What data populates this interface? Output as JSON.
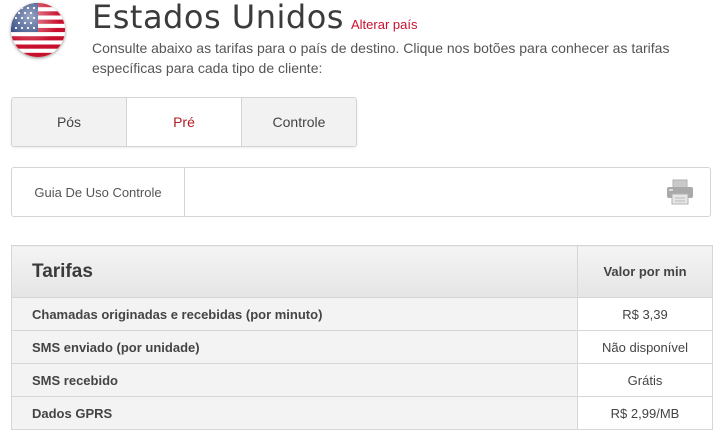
{
  "header": {
    "country_name": "Estados Unidos",
    "change_link": "Alterar país",
    "description": "Consulte abaixo as tarifas para o país de destino. Clique nos botões para conhecer as tarifas específicas para cada tipo de cliente:"
  },
  "tabs": [
    {
      "label": "Pós",
      "active": false
    },
    {
      "label": "Pré",
      "active": true
    },
    {
      "label": "Controle",
      "active": false
    }
  ],
  "guide": {
    "label": "Guia De Uso Controle",
    "print_icon": "printer-icon"
  },
  "tariffs": {
    "header_title": "Tarifas",
    "header_value": "Valor por min",
    "rows": [
      {
        "label": "Chamadas originadas e recebidas (por minuto)",
        "value": "R$ 3,39"
      },
      {
        "label": "SMS enviado (por unidade)",
        "value": "Não disponível"
      },
      {
        "label": "SMS recebido",
        "value": "Grátis"
      },
      {
        "label": "Dados GPRS",
        "value": "R$ 2,99/MB"
      }
    ]
  },
  "colors": {
    "accent": "#c8102e",
    "active_tab_text": "#b01e23",
    "tab_bg": "#f2f2f2",
    "border": "#d4d4d4"
  },
  "icons": {
    "flag": "usa-flag-icon",
    "print": "printer-icon"
  }
}
